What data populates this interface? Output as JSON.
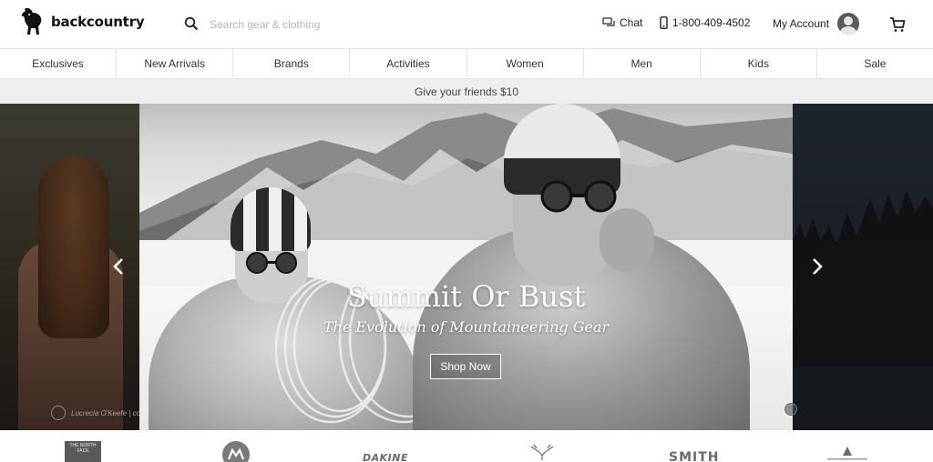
{
  "header": {
    "logo_text": "backcountry",
    "search_placeholder": "Search gear & clothing",
    "chat_label": "Chat",
    "phone_label": "1-800-409-4502",
    "account_label": "My Account"
  },
  "nav": {
    "items": [
      {
        "label": "Exclusives"
      },
      {
        "label": "New Arrivals"
      },
      {
        "label": "Brands"
      },
      {
        "label": "Activities"
      },
      {
        "label": "Women"
      },
      {
        "label": "Men"
      },
      {
        "label": "Kids"
      },
      {
        "label": "Sale"
      }
    ]
  },
  "promo": {
    "text": "Give your friends $10"
  },
  "hero": {
    "title": "Summit Or Bust",
    "subtitle": "The Evolution of Mountaineering Gear",
    "button_label": "Shop Now",
    "left_slide_credit": "Lucrecia O'Keefe | co"
  },
  "brands": {
    "dakine": "DAKINE",
    "smith": "SMITH",
    "tnf": "THE NORTH FACE"
  },
  "icons": {
    "search": "search-icon",
    "chat": "chat-icon",
    "phone": "phone-icon",
    "avatar": "user-avatar-icon",
    "cart": "cart-icon",
    "prev": "chevron-left-icon",
    "next": "chevron-right-icon"
  },
  "colors": {
    "promo_bg": "#efefef",
    "nav_border": "#e3e3e3",
    "text": "#222222"
  }
}
